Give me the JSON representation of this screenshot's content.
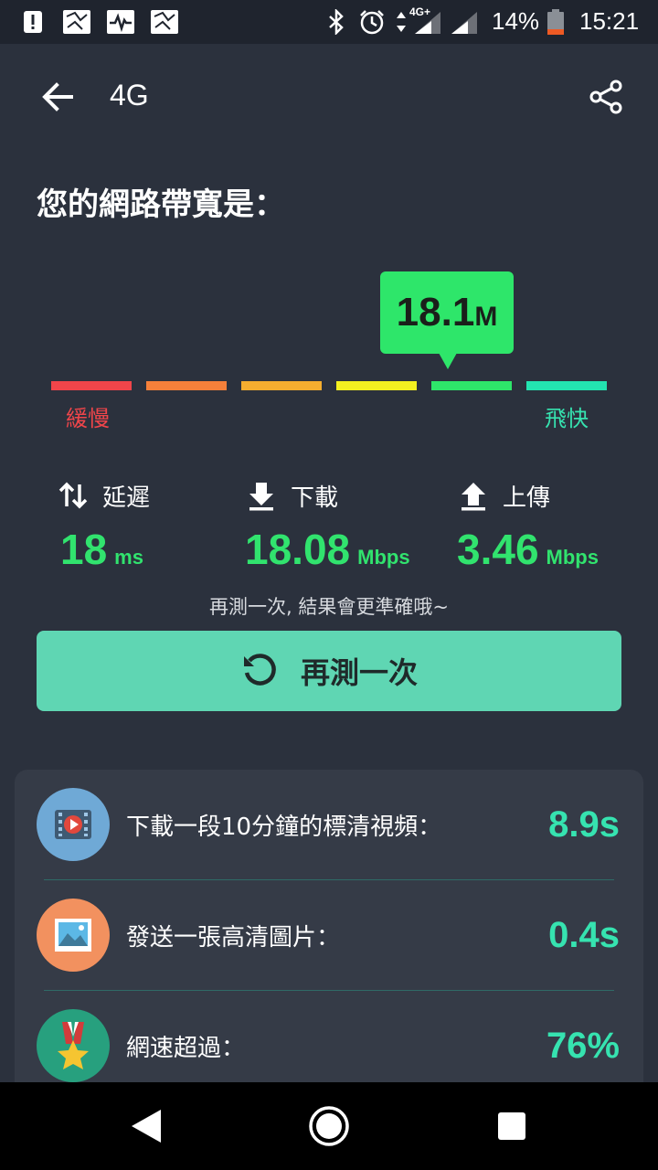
{
  "status_bar": {
    "battery_percent": "14%",
    "time": "15:21",
    "network_label": "4G+",
    "icons": [
      "alert-icon",
      "photo-icon",
      "activity-icon",
      "photo-icon-2",
      "bluetooth-icon",
      "alarm-icon",
      "data-arrows-icon",
      "signal-icon",
      "signal-icon-2",
      "battery-icon"
    ]
  },
  "app_bar": {
    "title": "4G",
    "back_icon": "back-arrow-icon",
    "share_icon": "share-icon"
  },
  "headline": "您的網路帶寬是：",
  "gauge": {
    "value": "18.1",
    "unit": "M",
    "selected_segment": 5,
    "segments": 6,
    "segment_colors": [
      "#f0454a",
      "#f5803a",
      "#f5ad2f",
      "#f3f020",
      "#2ee66a",
      "#23e3b0"
    ],
    "label_slow": "緩慢",
    "label_fast": "飛快"
  },
  "stats": {
    "latency": {
      "label": "延遲",
      "value": "18",
      "unit": "ms",
      "icon": "latency-arrows-icon"
    },
    "download": {
      "label": "下載",
      "value": "18.08",
      "unit": "Mbps",
      "icon": "download-icon"
    },
    "upload": {
      "label": "上傳",
      "value": "3.46",
      "unit": "Mbps",
      "icon": "upload-icon"
    }
  },
  "hint": "再測一次, 結果會更準確哦~",
  "retest_button": {
    "label": "再測一次",
    "icon": "refresh-icon"
  },
  "results": [
    {
      "label": "下載一段10分鐘的標清視頻：",
      "value": "8.9s",
      "icon": "video-icon",
      "icon_color": "#6fa9d6"
    },
    {
      "label": "發送一張高清圖片：",
      "value": "0.4s",
      "icon": "image-icon",
      "icon_color": "#f2915f"
    },
    {
      "label": "網速超過：",
      "value": "76%",
      "icon": "medal-icon",
      "icon_color": "#27a07e"
    }
  ],
  "colors": {
    "background": "#2b313d",
    "accent_green": "#31e36e",
    "accent_teal": "#36e3b0",
    "button": "#5fd6b3"
  },
  "nav_bar": {
    "icons": [
      "back-triangle-icon",
      "home-circle-icon",
      "recents-square-icon"
    ]
  }
}
